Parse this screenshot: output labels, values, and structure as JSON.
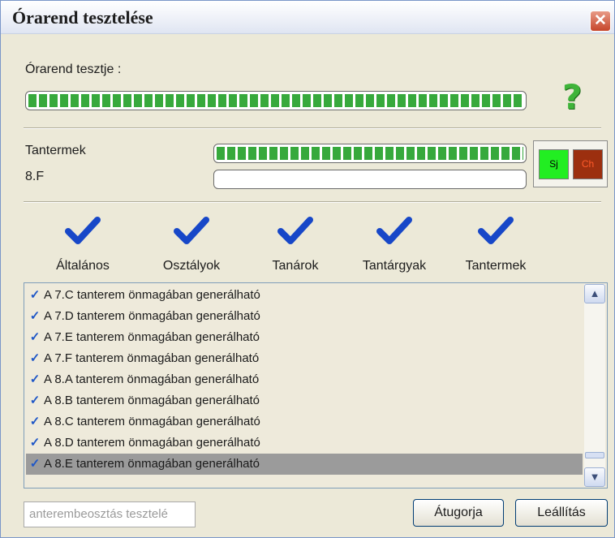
{
  "window": {
    "title": "Órarend tesztelése",
    "close_label": "✕"
  },
  "timetable_test": {
    "label": "Órarend tesztje :",
    "progress": 1.0,
    "status_icon": "question-icon"
  },
  "current": {
    "category": "Tantermek",
    "item": "8.F",
    "category_progress": 1.0,
    "item_progress": 0.0
  },
  "color_indicators": [
    {
      "label": "Sj",
      "color": "#22ee22"
    },
    {
      "label": "Ch",
      "color": "#9c2f0f"
    }
  ],
  "tabs": [
    {
      "label": "Általános",
      "icon": "check-icon",
      "status": "done"
    },
    {
      "label": "Osztályok",
      "icon": "check-icon",
      "status": "done"
    },
    {
      "label": "Tanárok",
      "icon": "check-icon",
      "status": "done"
    },
    {
      "label": "Tantárgyak",
      "icon": "check-icon",
      "status": "done"
    },
    {
      "label": "Tantermek",
      "icon": "check-icon",
      "status": "done"
    }
  ],
  "log": {
    "items": [
      {
        "text": "A 7.C tanterem önmagában generálható",
        "checked": true
      },
      {
        "text": "A 7.D tanterem önmagában generálható",
        "checked": true
      },
      {
        "text": "A 7.E tanterem önmagában generálható",
        "checked": true
      },
      {
        "text": "A 7.F tanterem önmagában generálható",
        "checked": true
      },
      {
        "text": "A 8.A tanterem önmagában generálható",
        "checked": true
      },
      {
        "text": "A 8.B tanterem önmagában generálható",
        "checked": true
      },
      {
        "text": "A 8.C tanterem önmagában generálható",
        "checked": true
      },
      {
        "text": "A 8.D tanterem önmagában generálható",
        "checked": true
      },
      {
        "text": "A 8.E tanterem önmagában generálható",
        "checked": true,
        "selected": true
      }
    ]
  },
  "bottom": {
    "status_text": "anterembeosztás tesztelé",
    "skip_label": "Átugorja",
    "stop_label": "Leállítás"
  },
  "colors": {
    "accent_check": "#1747c8",
    "progress_green": "#37a93c",
    "selection": "#9b9b9b"
  }
}
